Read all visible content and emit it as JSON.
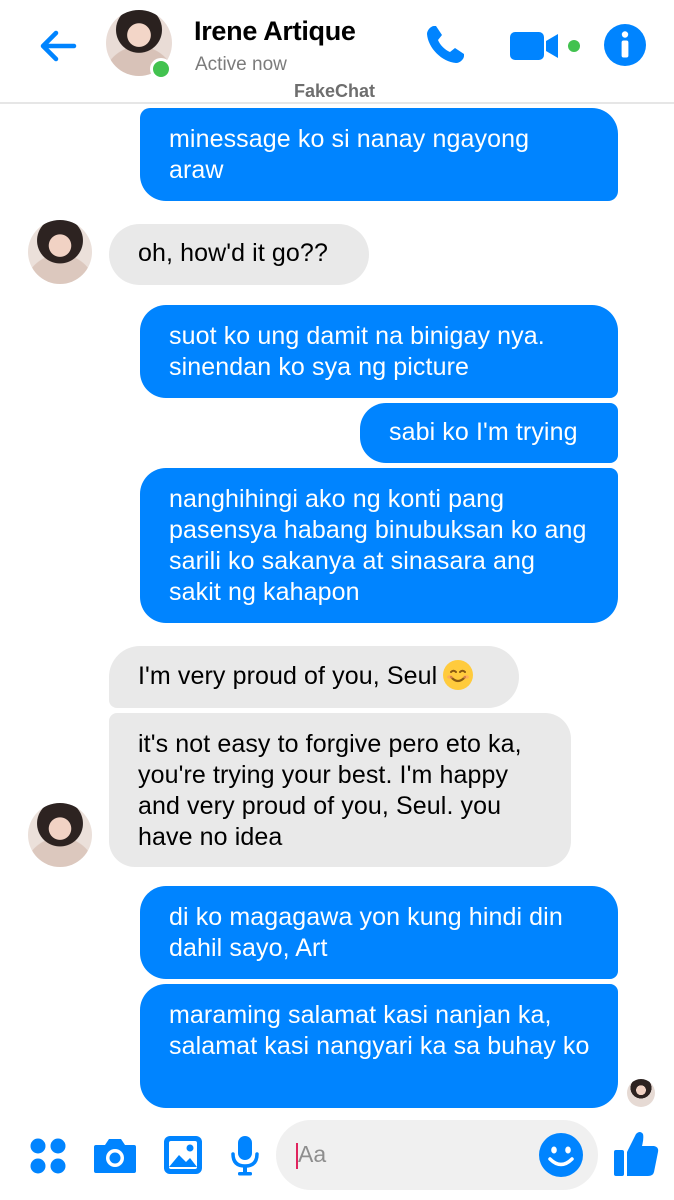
{
  "header": {
    "contact_name": "Irene Artique",
    "status": "Active now",
    "watermark": "FakeChat",
    "icons": [
      "back-arrow-icon",
      "phone-icon",
      "video-camera-icon",
      "info-icon"
    ],
    "accent_color": "#0084ff",
    "online_color": "#42c24f"
  },
  "messages": [
    {
      "from": "me",
      "text": "minessage ko si nanay ngayong araw"
    },
    {
      "from": "contact",
      "text": "oh, how'd it go??"
    },
    {
      "from": "me",
      "text": "suot ko ung damit na binigay nya. sinendan ko sya ng picture"
    },
    {
      "from": "me",
      "text": "sabi ko I'm trying"
    },
    {
      "from": "me",
      "text": "nanghihingi ako ng konti pang pasensya habang binubuksan ko ang sarili ko sakanya at sinasara ang sakit ng kahapon"
    },
    {
      "from": "contact",
      "text": "I'm very proud of you, Seul",
      "emoji": "smiling-face-icon"
    },
    {
      "from": "contact",
      "text": "it's not easy to forgive pero eto ka, you're trying your best. I'm happy and very proud of you, Seul. you have no idea"
    },
    {
      "from": "me",
      "text": "di ko magagawa yon kung hindi din dahil sayo, Art"
    },
    {
      "from": "me",
      "text": "maraming salamat kasi nanjan ka, salamat kasi nangyari ka sa buhay ko"
    }
  ],
  "composer": {
    "placeholder": "Aa",
    "icons": [
      "apps-grid-icon",
      "camera-icon",
      "image-icon",
      "microphone-icon",
      "emoji-icon",
      "thumbs-up-icon"
    ]
  },
  "colors": {
    "sent_bubble": "#0084ff",
    "received_bubble": "#e9e9e9"
  }
}
